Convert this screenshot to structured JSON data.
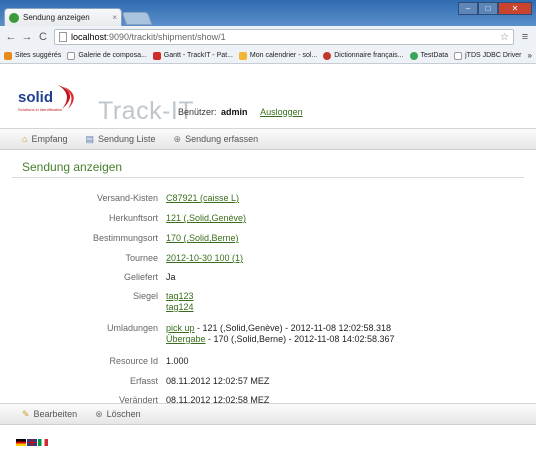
{
  "browser": {
    "tab_title": "Sendung anzeigen",
    "tab_close": "×",
    "url_host": "localhost",
    "url_path": ":9090/trackit/shipment/show/1",
    "bookmarks": [
      {
        "label": "Sites suggérés",
        "color": "#e88a1a"
      },
      {
        "label": "Galerie de composa...",
        "color": "#ffffff"
      },
      {
        "label": "Gantt - TrackIT - Pat...",
        "color": "#d12b2b"
      },
      {
        "label": "Mon calendrier - sol...",
        "color": "#f2b632"
      },
      {
        "label": "Dictionnaire français...",
        "color": "#c0392b"
      },
      {
        "label": "TestData",
        "color": "#3aa55a"
      },
      {
        "label": "jTDS JDBC Driver",
        "color": "#ffffff"
      }
    ],
    "bookmarks_more": "»"
  },
  "header": {
    "logo_text": "solid",
    "logo_sub": "Solutions in Identification",
    "app_title": "Track-IT",
    "user_label": "Benützer:",
    "user_name": "admin",
    "logout_label": "Ausloggen"
  },
  "nav": {
    "home": "Empfang",
    "list": "Sendung Liste",
    "create": "Sendung erfassen"
  },
  "section_title": "Sendung anzeigen",
  "fields": {
    "versand_label": "Versand-Kisten",
    "versand_value": "C87921 (caisse L)",
    "herkunft_label": "Herkunftsort",
    "herkunft_value": "121 (,Solid,Genève)",
    "bestimmung_label": "Bestimmungsort",
    "bestimmung_value": "170 (,Solid,Berne)",
    "tournee_label": "Tournee",
    "tournee_value": "2012-10-30 100 (1)",
    "geliefert_label": "Geliefert",
    "geliefert_value": "Ja",
    "siegel_label": "Siegel",
    "siegel_values": [
      "tag123",
      "tag124"
    ],
    "umladungen_label": "Umladungen",
    "umladungen": [
      {
        "link": "pick up",
        "rest": " - 121 (,Solid,Genève) - 2012-11-08 12:02:58.318"
      },
      {
        "link": "Übergabe",
        "rest": " - 170 (,Solid,Berne) - 2012-11-08 14:02:58.367"
      }
    ],
    "resource_label": "Resource Id",
    "resource_value": "1.000",
    "erfasst_label": "Erfasst",
    "erfasst_value": "08.11.2012 12:02:57 MEZ",
    "veraendert_label": "Verändert",
    "veraendert_value": "08.11.2012 12:02:58 MEZ"
  },
  "actions": {
    "edit": "Bearbeiten",
    "delete": "Löschen"
  }
}
